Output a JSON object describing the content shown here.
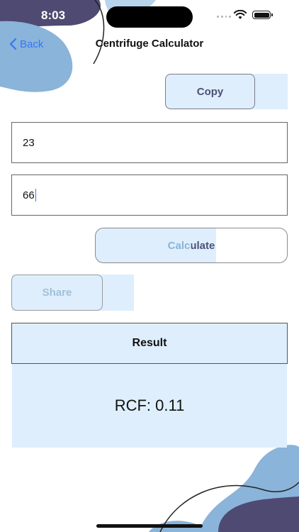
{
  "status_bar": {
    "time": "8:03"
  },
  "nav": {
    "back_label": "Back",
    "title": "Centrifuge Calculator"
  },
  "actions": {
    "copy_label": "Copy",
    "calculate_label": "Calculate",
    "share_label": "Share"
  },
  "inputs": [
    {
      "value": "23"
    },
    {
      "value": "66"
    }
  ],
  "result": {
    "header": "Result",
    "value": "RCF: 0.11"
  },
  "colors": {
    "accent_blue": "#3478f6",
    "panel_light_blue": "#deeefc",
    "decor_dark": "#4f4a72",
    "decor_light": "#8ab4d9"
  },
  "icons": {
    "back": "chevron-left",
    "signal": "cellular-signal",
    "wifi": "wifi",
    "battery": "battery"
  }
}
